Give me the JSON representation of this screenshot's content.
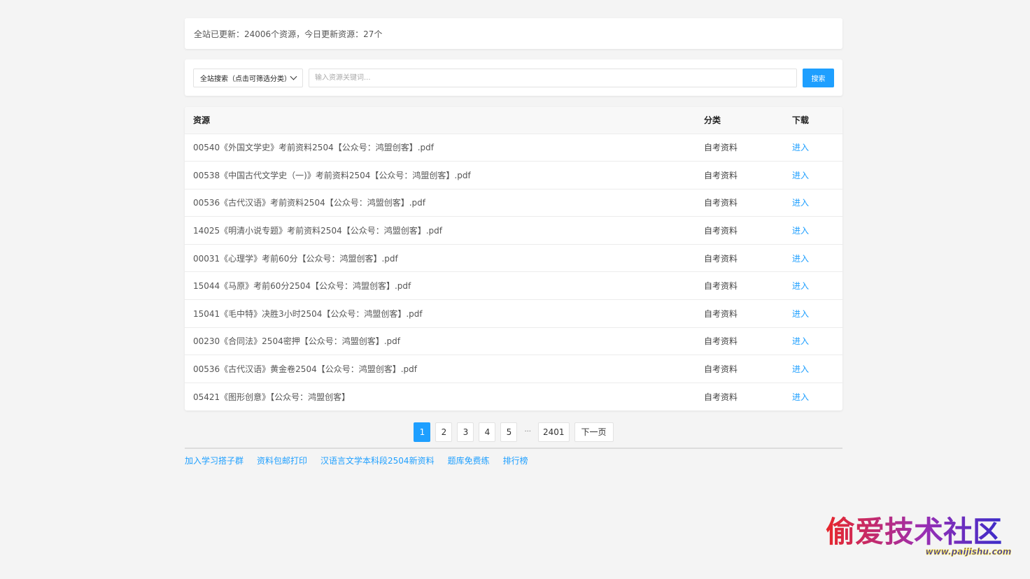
{
  "stats": {
    "text": "全站已更新：24006个资源，今日更新资源：27个"
  },
  "search": {
    "category_label": "全站搜索（点击可筛选分类）",
    "placeholder": "输入资源关键词...",
    "button_label": "搜索"
  },
  "table": {
    "headers": {
      "resource": "资源",
      "category": "分类",
      "download": "下载"
    },
    "rows": [
      {
        "name": "00540《外国文学史》考前资料2504【公众号：鸿盟创客】.pdf",
        "category": "自考资料",
        "link": "进入"
      },
      {
        "name": "00538《中国古代文学史（一)》考前资料2504【公众号：鸿盟创客】.pdf",
        "category": "自考资料",
        "link": "进入"
      },
      {
        "name": "00536《古代汉语》考前资料2504【公众号：鸿盟创客】.pdf",
        "category": "自考资料",
        "link": "进入"
      },
      {
        "name": "14025《明清小说专题》考前资料2504【公众号：鸿盟创客】.pdf",
        "category": "自考资料",
        "link": "进入"
      },
      {
        "name": "00031《心理学》考前60分【公众号：鸿盟创客】.pdf",
        "category": "自考资料",
        "link": "进入"
      },
      {
        "name": "15044《马原》考前60分2504【公众号：鸿盟创客】.pdf",
        "category": "自考资料",
        "link": "进入"
      },
      {
        "name": "15041《毛中特》决胜3小时2504【公众号：鸿盟创客】.pdf",
        "category": "自考资料",
        "link": "进入"
      },
      {
        "name": "00230《合同法》2504密押【公众号：鸿盟创客】.pdf",
        "category": "自考资料",
        "link": "进入"
      },
      {
        "name": "00536《古代汉语》黄金卷2504【公众号：鸿盟创客】.pdf",
        "category": "自考资料",
        "link": "进入"
      },
      {
        "name": "05421《图形创意》【公众号：鸿盟创客】",
        "category": "自考资料",
        "link": "进入"
      }
    ]
  },
  "pagination": {
    "pages": [
      "1",
      "2",
      "3",
      "4",
      "5"
    ],
    "current": "1",
    "ellipsis": "···",
    "last": "2401",
    "next": "下一页"
  },
  "footer": {
    "links": [
      "加入学习搭子群",
      "资料包邮打印",
      "汉语言文学本科段2504新资料",
      "题库免费练",
      "排行榜"
    ]
  },
  "watermark": {
    "title": "偷爱技术社区",
    "url": "www.paijishu.com",
    "colors": [
      "#e8262a",
      "#9b2fb3",
      "#3a2bc9"
    ]
  },
  "colors": {
    "accent": "#1e9fff",
    "background": "#f4f4f4"
  }
}
